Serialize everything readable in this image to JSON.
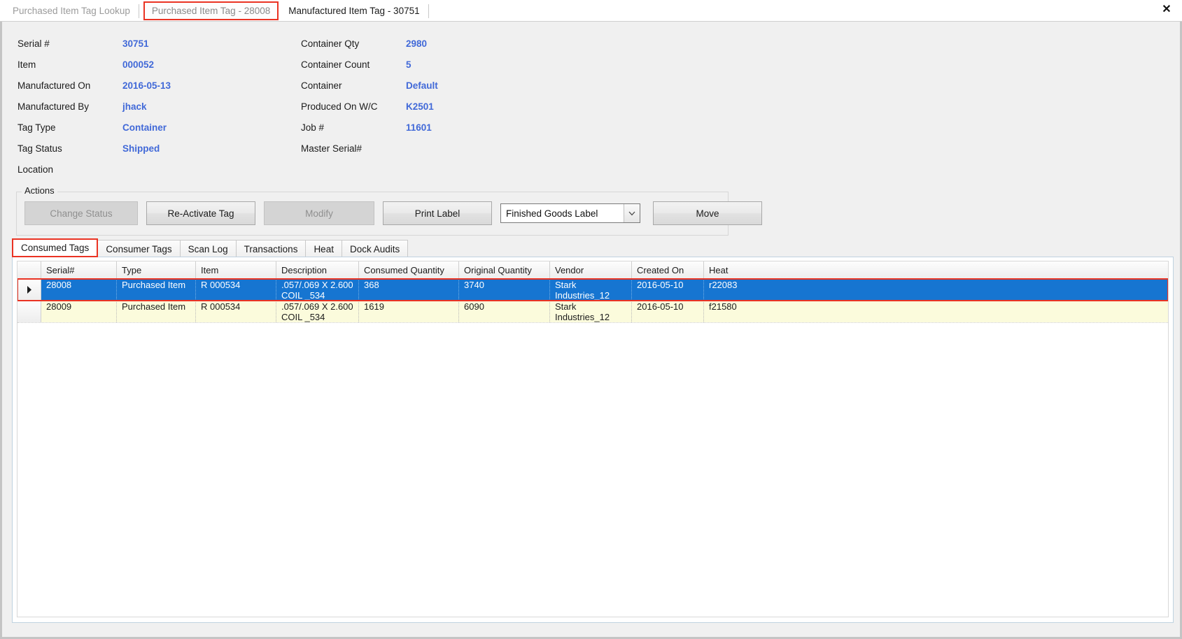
{
  "window": {
    "close_icon": "close-icon",
    "close_glyph": "✕"
  },
  "document_tabs": [
    {
      "label": "Purchased Item Tag Lookup",
      "state": "inactive"
    },
    {
      "label": "Purchased Item Tag - 28008",
      "state": "highlighted"
    },
    {
      "label": "Manufactured Item Tag - 30751",
      "state": "current"
    }
  ],
  "details": {
    "left": [
      {
        "label": "Serial #",
        "value": "30751"
      },
      {
        "label": "Item",
        "value": "000052"
      },
      {
        "label": "Manufactured On",
        "value": "2016-05-13"
      },
      {
        "label": "Manufactured By",
        "value": "jhack"
      },
      {
        "label": "Tag Type",
        "value": "Container"
      },
      {
        "label": "Tag Status",
        "value": "Shipped"
      },
      {
        "label": "Location",
        "value": ""
      }
    ],
    "right": [
      {
        "label": "Container Qty",
        "value": "2980"
      },
      {
        "label": "Container Count",
        "value": "5"
      },
      {
        "label": "Container",
        "value": "Default"
      },
      {
        "label": "Produced On W/C",
        "value": "K2501"
      },
      {
        "label": "Job #",
        "value": "11601"
      },
      {
        "label": "Master Serial#",
        "value": ""
      }
    ],
    "value_color": "#4169d8"
  },
  "actions": {
    "group_title": "Actions",
    "buttons": [
      {
        "label": "Change Status",
        "enabled": false
      },
      {
        "label": "Re-Activate Tag",
        "enabled": true
      },
      {
        "label": "Modify",
        "enabled": false
      },
      {
        "label": "Print Label",
        "enabled": true
      },
      {
        "label": "Move",
        "enabled": true
      }
    ],
    "label_select": {
      "value": "Finished Goods Label",
      "arrow_icon": "chevron-down-icon"
    }
  },
  "inner_tabs": [
    {
      "label": "Consumed Tags",
      "selected": true
    },
    {
      "label": "Consumer Tags",
      "selected": false
    },
    {
      "label": "Scan Log",
      "selected": false
    },
    {
      "label": "Transactions",
      "selected": false
    },
    {
      "label": "Heat",
      "selected": false
    },
    {
      "label": "Dock Audits",
      "selected": false
    }
  ],
  "grid": {
    "columns": [
      "Serial#",
      "Type",
      "Item",
      "Description",
      "Consumed Quantity",
      "Original Quantity",
      "Vendor",
      "Created On",
      "Heat"
    ],
    "row_indicator_icon": "row-selector-arrow-icon",
    "rows": [
      {
        "selected": true,
        "cells": [
          "28008",
          "Purchased Item",
          "R 000534",
          ".057/.069 X 2.600\nCOIL  _534",
          "368",
          "3740",
          "Stark\nIndustries_12",
          "2016-05-10",
          "r22083"
        ]
      },
      {
        "selected": false,
        "cells": [
          "28009",
          "Purchased Item",
          "R 000534",
          ".057/.069 X 2.600\nCOIL  _534",
          "1619",
          "6090",
          "Stark\nIndustries_12",
          "2016-05-10",
          "f21580"
        ]
      }
    ],
    "selected_row_color": "#1675d1",
    "alt_row_color": "#fbfbdc",
    "highlight_color": "#ea3323"
  }
}
